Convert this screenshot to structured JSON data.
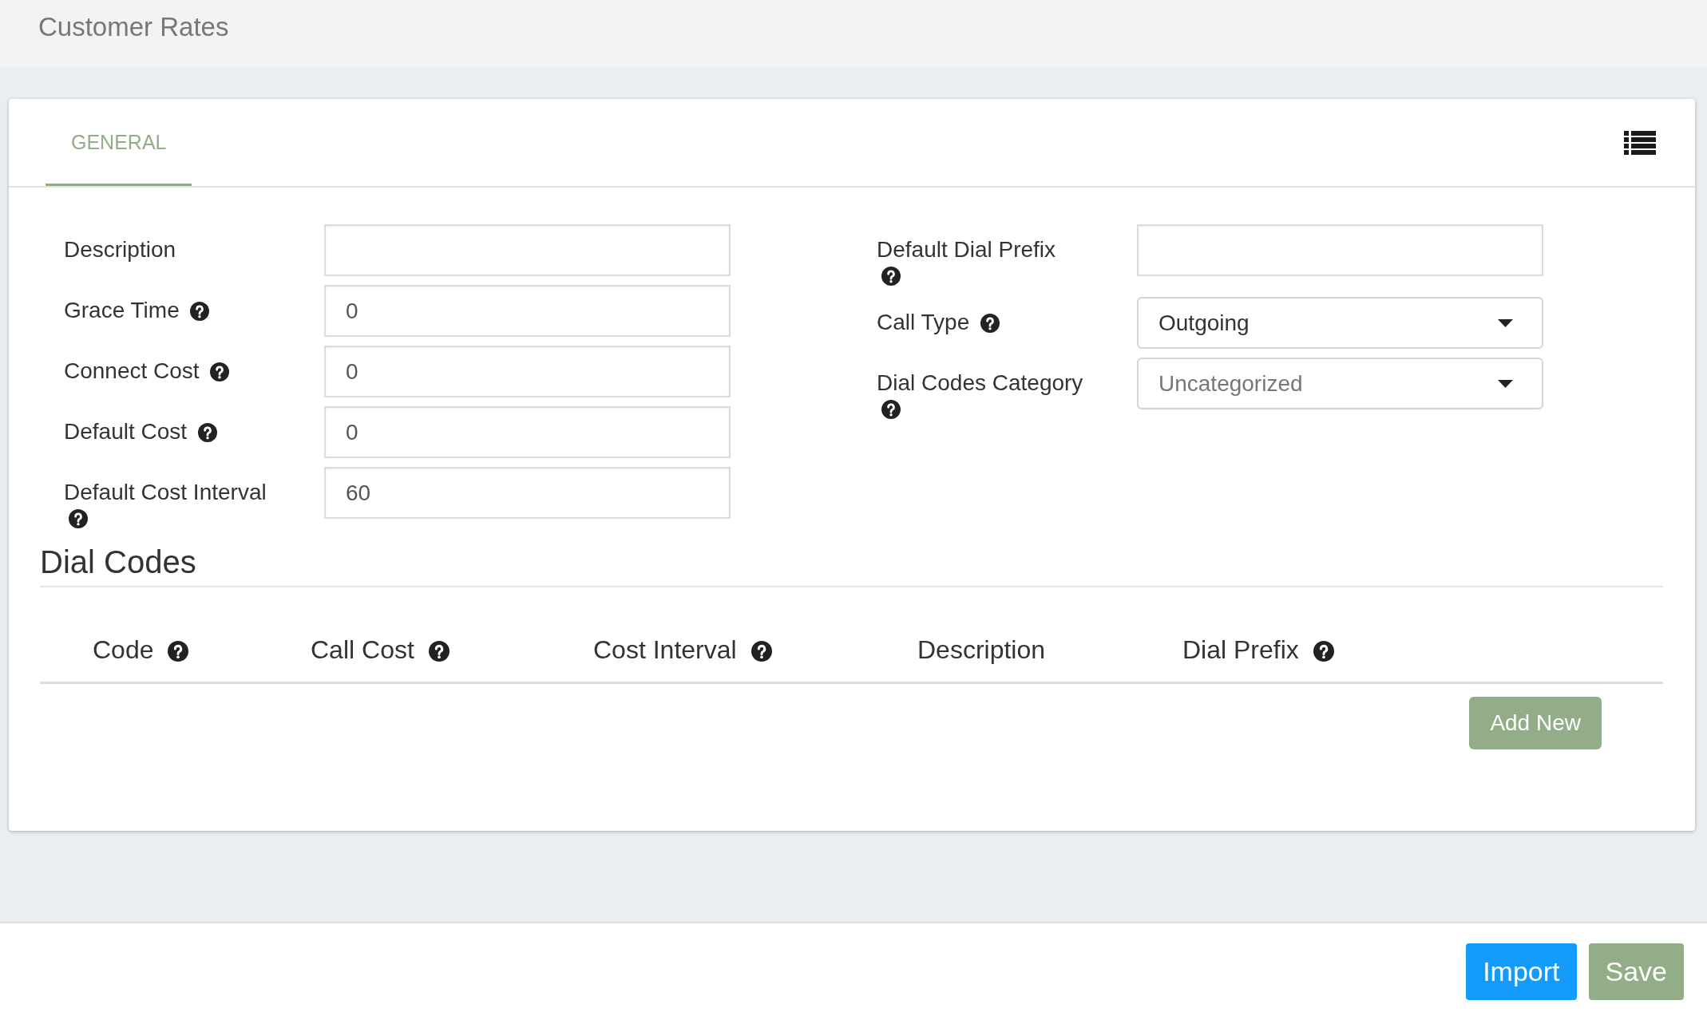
{
  "page": {
    "title": "Customer Rates"
  },
  "tabs": [
    {
      "label": "GENERAL",
      "selected": true
    }
  ],
  "form": {
    "columns": [
      {
        "fields": [
          {
            "kind": "text",
            "label": "Description",
            "help": false
          },
          {
            "kind": "text",
            "label": "Grace Time",
            "help": true,
            "value": "0"
          },
          {
            "kind": "text",
            "label": "Connect Cost",
            "help": true,
            "value": "0"
          },
          {
            "kind": "text",
            "label": "Default Cost",
            "help": true,
            "value": "0"
          },
          {
            "kind": "text",
            "label": "Default Cost Interval",
            "help": true,
            "value": "60"
          }
        ]
      },
      {
        "fields": [
          {
            "kind": "text",
            "label": "Default Dial Prefix",
            "help": true
          },
          {
            "kind": "select",
            "label": "Call Type",
            "help": true,
            "value": "Outgoing"
          },
          {
            "kind": "select",
            "label": "Dial Codes Category",
            "help": true,
            "placeholder": "Uncategorized"
          }
        ]
      }
    ]
  },
  "dial_codes": {
    "title": "Dial Codes",
    "columns": [
      {
        "label": "Code",
        "help": true
      },
      {
        "label": "Call Cost",
        "help": true
      },
      {
        "label": "Cost Interval",
        "help": true
      },
      {
        "label": "Description",
        "help": false
      },
      {
        "label": "Dial Prefix",
        "help": true
      }
    ],
    "add_button": "Add New"
  },
  "footer": {
    "buttons": [
      {
        "label": "Import",
        "kind": "primary"
      },
      {
        "label": "Save",
        "kind": "success"
      }
    ]
  }
}
